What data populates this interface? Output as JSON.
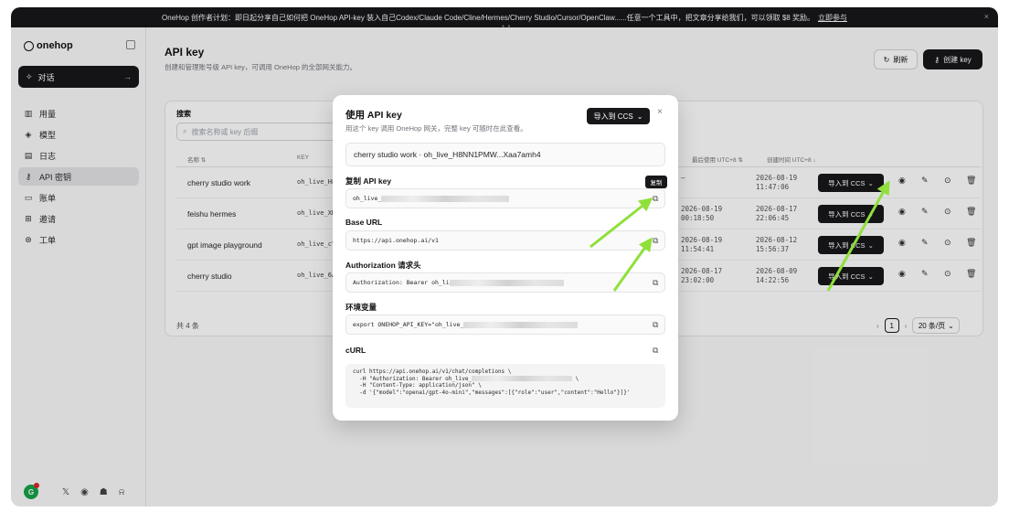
{
  "banner": {
    "text": "OneHop 创作者计划：即日起分享自己如何把 OneHop API-key 装入自己Codex/Claude Code/Cline/Hermes/Cherry Studio/Cursor/OpenClaw......任意一个工具中，把文章分享给我们，可以领取 $8 奖励。",
    "cta": "立即参与",
    "close": "×"
  },
  "sidebar": {
    "logo": "onehop",
    "chat_label": "对话",
    "items": [
      {
        "label": "用量",
        "icon": "chart-icon"
      },
      {
        "label": "模型",
        "icon": "cube-icon"
      },
      {
        "label": "日志",
        "icon": "log-icon"
      },
      {
        "label": "API 密钥",
        "icon": "key-icon"
      },
      {
        "label": "账单",
        "icon": "card-icon"
      },
      {
        "label": "邀请",
        "icon": "gift-icon"
      },
      {
        "label": "工单",
        "icon": "ticket-icon"
      }
    ],
    "avatar_initial": "G"
  },
  "header": {
    "title": "API key",
    "subtitle": "创建和管理账号级 API key，可调用 OneHop 的全部网关能力。",
    "refresh_label": "刷新",
    "create_label": "创建 key"
  },
  "table": {
    "search_label": "搜索",
    "search_placeholder": "搜索名称或 key 后缀",
    "columns": {
      "name": "名称 ⇅",
      "key": "KEY",
      "last_used": "最后使用 UTC+8 ⇅",
      "created": "创建时间 UTC+8 ↓"
    },
    "rows": [
      {
        "name": "cherry studio work",
        "key": "oh_live_H8N",
        "last_used_1": "—",
        "last_used_2": "",
        "created_1": "2026-08-19",
        "created_2": "11:47:06"
      },
      {
        "name": "feishu hermes",
        "key": "oh_live_XHt",
        "last_used_1": "2026-08-19",
        "last_used_2": "00:18:50",
        "created_1": "2026-08-17",
        "created_2": "22:06:45"
      },
      {
        "name": "gpt image playground",
        "key": "oh_live_cYD",
        "last_used_1": "2026-08-19",
        "last_used_2": "11:54:41",
        "created_1": "2026-08-12",
        "created_2": "15:56:37"
      },
      {
        "name": "cherry studio",
        "key": "oh_live_6A1",
        "last_used_1": "2026-08-17",
        "last_used_2": "23:02:00",
        "created_1": "2026-08-09",
        "created_2": "14:22:56"
      }
    ],
    "import_label": "导入到 CCS",
    "total": "共 4 条",
    "page": "1",
    "per_page": "20 条/页"
  },
  "modal": {
    "title": "使用 API key",
    "subtitle": "用这个 key 调用 OneHop 网关，完整 key 可随时在此查看。",
    "import_label": "导入到 CCS",
    "close": "×",
    "summary": "cherry studio work · oh_live_H8NN1PMW...Xaa7amh4",
    "copy_key_label": "复制 API key",
    "key_prefix": "oh_live_",
    "tooltip": "复制",
    "base_url_label": "Base URL",
    "base_url": "https://api.onehop.ai/v1",
    "auth_label": "Authorization 请求头",
    "auth_prefix": "Authorization: Bearer oh_li",
    "env_label": "环境变量",
    "env_prefix": "export ONEHOP_API_KEY=\"oh_live_",
    "curl_label": "cURL",
    "curl_line1": "curl https://api.onehop.ai/v1/chat/completions \\",
    "curl_line2a": "  -H \"Authorization: Bearer oh_live_",
    "curl_line2b": " \\",
    "curl_line3": "  -H \"Content-Type: application/json\" \\",
    "curl_line4": "  -d '{\"model\":\"openai/gpt-4o-mini\",\"messages\":[{\"role\":\"user\",\"content\":\"Hello\"}]}'"
  },
  "colors": {
    "accent": "#18181b",
    "annotation_arrow": "#8fe03a",
    "avatar": "#16a34a"
  }
}
